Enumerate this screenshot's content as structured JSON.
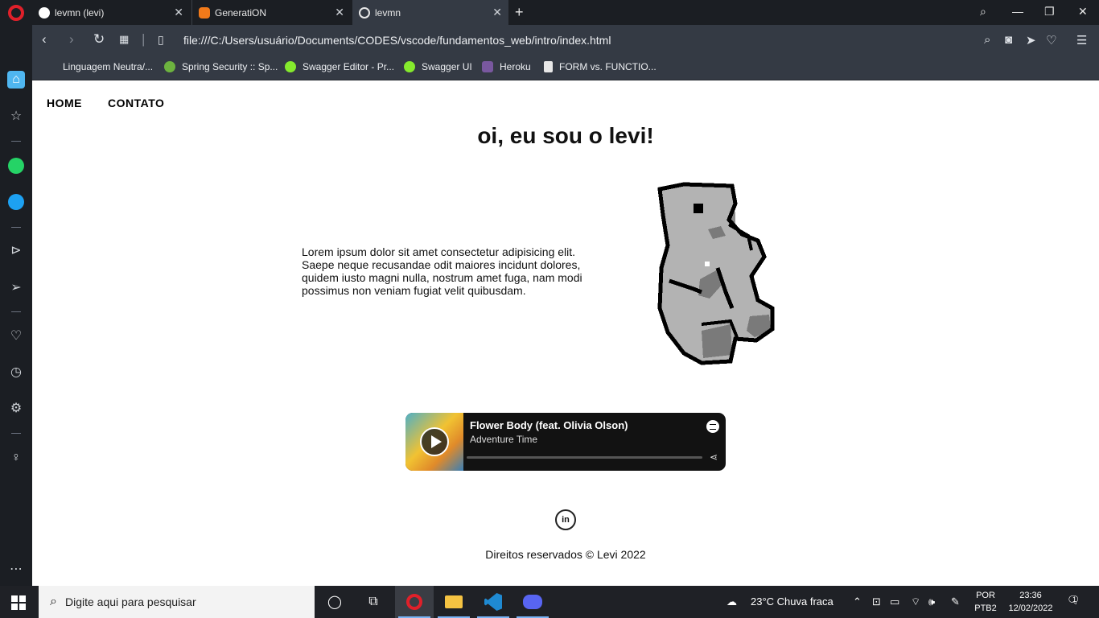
{
  "browser": {
    "tabs": [
      {
        "label": "levmn (levi)",
        "icon": "github-icon"
      },
      {
        "label": "GeneratiON",
        "icon": "cloud-icon"
      },
      {
        "label": "levmn",
        "icon": "globe-icon",
        "active": true
      }
    ],
    "url": "file:///C:/Users/usuário/Documents/CODES/vscode/fundamentos_web/intro/index.html",
    "bookmarks": [
      {
        "label": "Linguagem Neutra/...",
        "icon": ""
      },
      {
        "label": "Spring Security :: Sp...",
        "icon": "spring-icon",
        "color": "#6db33f"
      },
      {
        "label": "Swagger Editor - Pr...",
        "icon": "swagger-icon",
        "color": "#85ea2d"
      },
      {
        "label": "Swagger UI",
        "icon": "swagger-icon",
        "color": "#85ea2d"
      },
      {
        "label": "Heroku",
        "icon": "heroku-icon",
        "color": "#79589f"
      },
      {
        "label": "FORM vs. FUNCTIO...",
        "icon": "page-icon",
        "color": "#e8e8e8"
      }
    ]
  },
  "page": {
    "nav": {
      "home": "HOME",
      "contact": "CONTATO"
    },
    "title": "oi, eu sou o levi!",
    "intro": "Lorem ipsum dolor sit amet consectetur adipisicing elit. Saepe neque recusandae odit maiores incidunt dolores, quidem iusto magni nulla, nostrum amet fuga, nam modi possimus non veniam fugiat velit quibusdam.",
    "spotify": {
      "track": "Flower Body (feat. Olivia Olson)",
      "artist": "Adventure Time"
    },
    "footer": "Direitos reservados © Levi 2022",
    "linkedin_label": "in"
  },
  "taskbar": {
    "search_placeholder": "Digite aqui para pesquisar",
    "weather": "23°C  Chuva fraca",
    "lang_top": "POR",
    "lang_bottom": "PTB2",
    "time": "23:36",
    "date": "12/02/2022",
    "notifications": "1"
  },
  "colors": {
    "chrome_dark": "#1b1e23",
    "chrome_mid": "#343a44",
    "opera_red": "#e0202a",
    "spotify_bg": "#121212"
  }
}
